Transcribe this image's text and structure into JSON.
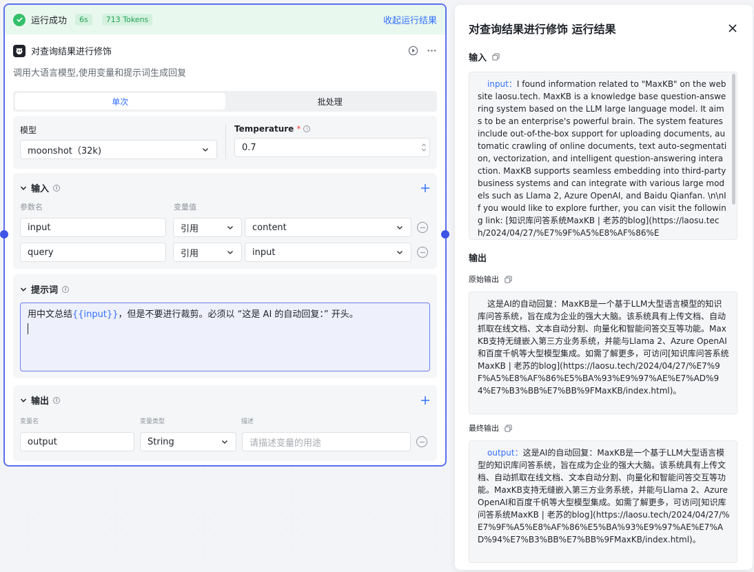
{
  "node": {
    "status_text": "运行成功",
    "duration": "6s",
    "tokens": "713 Tokens",
    "collapse_label": "收起运行结果",
    "title": "对查询结果进行修饰",
    "description": "调用大语言模型,使用变量和提示词生成回复",
    "tabs": [
      {
        "label": "单次",
        "active": true
      },
      {
        "label": "批处理",
        "active": false
      }
    ],
    "model": {
      "label": "模型",
      "value": "moonshot（32k)"
    },
    "temperature": {
      "label": "Temperature",
      "required_mark": "*",
      "value": "0.7"
    },
    "inputs": {
      "title": "输入",
      "col_name": "参数名",
      "col_value": "变量值",
      "rows": [
        {
          "name": "input",
          "ref": "引用",
          "value": "content"
        },
        {
          "name": "query",
          "ref": "引用",
          "value": "input"
        }
      ]
    },
    "prompt": {
      "title": "提示词",
      "before": "用中文总结",
      "var": "{{input}}",
      "after": "，但是不要进行裁剪。必须以 “这是 AI 的自动回复：” 开头。"
    },
    "outputs": {
      "title": "输出",
      "col_name": "变量名",
      "col_type": "变量类型",
      "col_desc": "描述",
      "row": {
        "name": "output",
        "type": "String",
        "desc_placeholder": "请描述变量的用途"
      }
    }
  },
  "panel": {
    "title": "对查询结果进行修饰 运行结果",
    "input_label": "输入",
    "input_key": "input：",
    "input_text": "I found information related to \"MaxKB\" on the website laosu.tech. MaxKB is a knowledge base question-answering system based on the LLM large language model. It aims to be an enterprise's powerful brain. The system features include out-of-the-box support for uploading documents, automatic crawling of online documents, text auto-segmentation, vectorization, and intelligent question-answering interaction. MaxKB supports seamless embedding into third-party business systems and can integrate with various large models such as Llama 2, Azure OpenAI, and Baidu Qianfan. \\n\\nIf you would like to explore further, you can visit the following link: [知识库问答系统MaxKB | 老苏的blog](https://laosu.tech/2024/04/27/%E7%9F%A5%E8%AF%86%E",
    "output_label": "输出",
    "raw_output_label": "原始输出",
    "raw_output_text": "这是AI的自动回复：MaxKB是一个基于LLM大型语言模型的知识库问答系统，旨在成为企业的强大大脑。该系统具有上传文档、自动抓取在线文档、文本自动分割、向量化和智能问答交互等功能。MaxKB支持无缝嵌入第三方业务系统，并能与Llama 2、Azure OpenAI和百度千帆等大型模型集成。如需了解更多，可访问[知识库问答系统MaxKB | 老苏的blog](https://laosu.tech/2024/04/27/%E7%9F%A5%E8%AF%86%E5%BA%93%E9%97%AE%E7%AD%94%E7%B3%BB%E7%BB%9FMaxKB/index.html)。",
    "final_output_label": "最终输出",
    "final_output_key": "output：",
    "final_output_text": "这是AI的自动回复：MaxKB是一个基于LLM大型语言模型的知识库问答系统，旨在成为企业的强大大脑。该系统具有上传文档、自动抓取在线文档、文本自动分割、向量化和智能问答交互等功能。MaxKB支持无缝嵌入第三方业务系统，并能与Llama 2、Azure OpenAI和百度千帆等大型模型集成。如需了解更多，可访问[知识库问答系统MaxKB | 老苏的blog](https://laosu.tech/2024/04/27/%E7%9F%A5%E8%AF%86%E5%BA%93%E9%97%AE%E7%AD%94%E7%B3%BB%E7%BB%9FMaxKB/index.html)。"
  }
}
